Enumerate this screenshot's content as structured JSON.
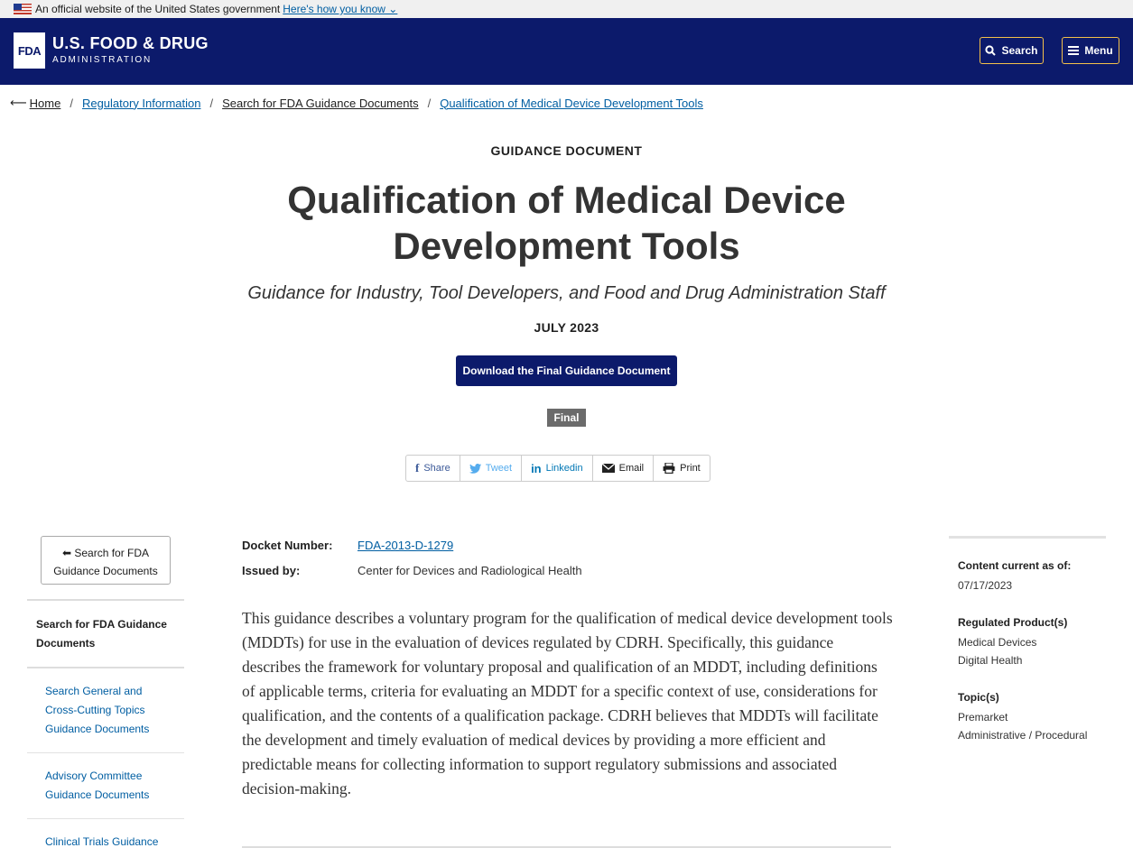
{
  "gov_banner": {
    "text": "An official website of the United States government",
    "link": "Here's how you know"
  },
  "header": {
    "logo_text": "FDA",
    "title": "U.S. FOOD & DRUG",
    "subtitle": "ADMINISTRATION",
    "search_label": "Search",
    "menu_label": "Menu"
  },
  "breadcrumb": [
    "Home",
    "Regulatory Information",
    "Search for FDA Guidance Documents",
    "Qualification of Medical Device Development Tools"
  ],
  "doc": {
    "type": "GUIDANCE DOCUMENT",
    "title_line1": "Qualification of Medical Device",
    "title_line2": "Development Tools",
    "subtitle": "Guidance for Industry, Tool Developers, and Food and Drug Administration Staff",
    "date": "JULY 2023",
    "download_label": "Download the Final Guidance Document",
    "status": "Final"
  },
  "share": {
    "share": "Share",
    "tweet": "Tweet",
    "linkedin": "Linkedin",
    "email": "Email",
    "print": "Print"
  },
  "left_nav": {
    "back_line1": "Search for FDA",
    "back_line2": "Guidance Documents",
    "heading_line1": "Search for FDA Guidance",
    "heading_line2": "Documents",
    "items": [
      [
        "Search General and",
        "Cross-Cutting Topics",
        "Guidance Documents"
      ],
      [
        "Advisory Committee",
        "Guidance Documents"
      ],
      [
        "Clinical Trials Guidance"
      ]
    ]
  },
  "meta": {
    "docket_label": "Docket Number:",
    "docket_value": "FDA-2013-D-1279",
    "issued_label": "Issued by:",
    "issued_value": "Center for Devices and Radiological Health"
  },
  "body": "This guidance describes a voluntary program for the qualification of medical device development tools (MDDTs) for use in the evaluation of devices regulated by CDRH.  Specifically, this guidance describes the framework for voluntary proposal and qualification of an MDDT, including definitions of applicable terms, criteria for evaluating an MDDT for a specific context of use, considerations for qualification, and the contents of a qualification package. CDRH believes that MDDTs will facilitate the development and timely evaluation of medical devices by providing a more efficient and predictable means for collecting information to support regulatory submissions and associated decision-making.",
  "sidebar": {
    "current_label": "Content current as of:",
    "current_value": "07/17/2023",
    "products_label": "Regulated Product(s)",
    "products": [
      "Medical Devices",
      "Digital Health"
    ],
    "topics_label": "Topic(s)",
    "topics": [
      "Premarket",
      "Administrative / Procedural"
    ]
  },
  "colors": {
    "header_bg": "#0c1a6b",
    "link": "#005ea2",
    "accent_border": "#f3c04a"
  }
}
